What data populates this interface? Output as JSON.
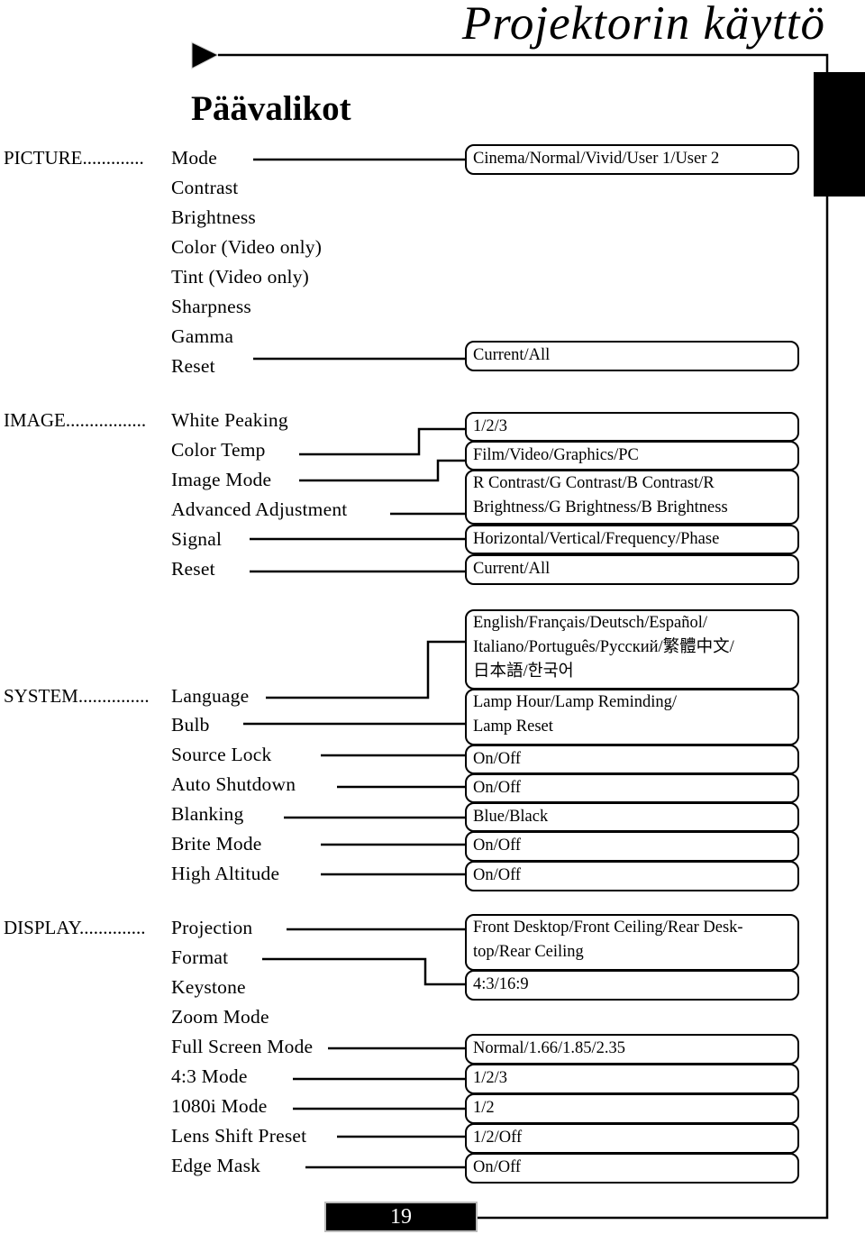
{
  "header": {
    "title": "Projektorin käyttö",
    "section_title": "Päävalikot"
  },
  "menus": [
    {
      "category": "PICTURE.............",
      "items": [
        "Mode",
        "Contrast",
        "Brightness",
        "Color (Video only)",
        "Tint (Video only)",
        "Sharpness",
        "Gamma",
        "Reset"
      ],
      "options": [
        {
          "lines": [
            "Cinema/Normal/Vivid/User 1/User 2"
          ]
        },
        {
          "lines": [
            "Current/All"
          ]
        }
      ]
    },
    {
      "category": "IMAGE.................",
      "items": [
        "White Peaking",
        "Color Temp",
        "Image Mode",
        "Advanced Adjustment",
        "Signal",
        "Reset"
      ],
      "options": [
        {
          "lines": [
            "1/2/3"
          ]
        },
        {
          "lines": [
            "Film/Video/Graphics/PC"
          ]
        },
        {
          "lines": [
            "R Contrast/G Contrast/B Contrast/R",
            "Brightness/G Brightness/B Brightness"
          ]
        },
        {
          "lines": [
            "Horizontal/Vertical/Frequency/Phase"
          ]
        },
        {
          "lines": [
            "Current/All"
          ]
        }
      ]
    },
    {
      "category": "SYSTEM...............",
      "items": [
        "Language",
        "Bulb",
        "Source Lock",
        "Auto Shutdown",
        "Blanking",
        "Brite Mode",
        "High Altitude"
      ],
      "options": [
        {
          "lines": [
            "English/Français/Deutsch/Español/",
            "Italiano/Português/Русский/繁體中文/",
            "日本語/한국어"
          ]
        },
        {
          "lines": [
            "Lamp Hour/Lamp Reminding/",
            "Lamp Reset"
          ]
        },
        {
          "lines": [
            "On/Off"
          ]
        },
        {
          "lines": [
            "On/Off"
          ]
        },
        {
          "lines": [
            "Blue/Black"
          ]
        },
        {
          "lines": [
            "On/Off"
          ]
        },
        {
          "lines": [
            "On/Off"
          ]
        }
      ]
    },
    {
      "category": "DISPLAY..............",
      "items": [
        "Projection",
        "Format",
        "Keystone",
        "Zoom Mode",
        "Full Screen Mode",
        "4:3 Mode",
        "1080i Mode",
        "Lens Shift Preset",
        "Edge Mask"
      ],
      "options": [
        {
          "lines": [
            "Front Desktop/Front Ceiling/Rear Desk-",
            "top/Rear Ceiling"
          ]
        },
        {
          "lines": [
            "4:3/16:9"
          ]
        },
        {
          "lines": [
            "Normal/1.66/1.85/2.35"
          ]
        },
        {
          "lines": [
            "1/2/3"
          ]
        },
        {
          "lines": [
            "1/2"
          ]
        },
        {
          "lines": [
            "1/2/Off"
          ]
        },
        {
          "lines": [
            "On/Off"
          ]
        }
      ]
    }
  ],
  "footer": {
    "page_number": "19"
  }
}
